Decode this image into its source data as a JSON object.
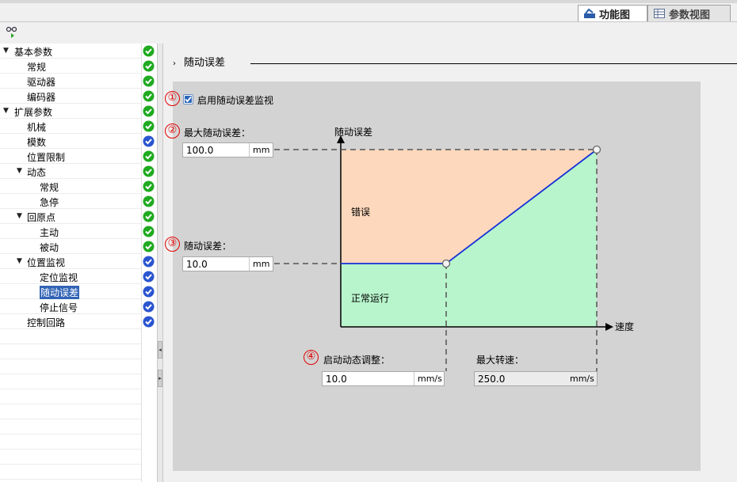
{
  "tabs": {
    "functional_view": "功能图",
    "parameter_view": "参数视图"
  },
  "tree": {
    "items": [
      {
        "label": "基本参数",
        "level": 0,
        "expanded": true,
        "status": "ok"
      },
      {
        "label": "常规",
        "level": 1,
        "status": "ok"
      },
      {
        "label": "驱动器",
        "level": 1,
        "status": "ok"
      },
      {
        "label": "编码器",
        "level": 1,
        "status": "ok"
      },
      {
        "label": "扩展参数",
        "level": 0,
        "expanded": true,
        "status": "ok"
      },
      {
        "label": "机械",
        "level": 1,
        "status": "ok"
      },
      {
        "label": "模数",
        "level": 1,
        "status": "info"
      },
      {
        "label": "位置限制",
        "level": 1,
        "status": "ok"
      },
      {
        "label": "动态",
        "level": 1,
        "expanded": true,
        "status": "ok"
      },
      {
        "label": "常规",
        "level": 2,
        "status": "ok"
      },
      {
        "label": "急停",
        "level": 2,
        "status": "ok"
      },
      {
        "label": "回原点",
        "level": 1,
        "expanded": true,
        "status": "ok"
      },
      {
        "label": "主动",
        "level": 2,
        "status": "ok"
      },
      {
        "label": "被动",
        "level": 2,
        "status": "ok"
      },
      {
        "label": "位置监视",
        "level": 1,
        "expanded": true,
        "status": "info"
      },
      {
        "label": "定位监视",
        "level": 2,
        "status": "info"
      },
      {
        "label": "随动误差",
        "level": 2,
        "status": "info",
        "selected": true
      },
      {
        "label": "停止信号",
        "level": 2,
        "status": "info"
      },
      {
        "label": "控制回路",
        "level": 1,
        "status": "info"
      }
    ]
  },
  "section": {
    "title": "随动误差"
  },
  "form": {
    "enable_checkbox": {
      "number": "①",
      "label": "启用随动误差监视",
      "checked": true
    },
    "max_following_error": {
      "number": "②",
      "label": "最大随动误差：",
      "value": "100.0",
      "unit": "mm"
    },
    "following_error": {
      "number": "③",
      "label": "随动误差：",
      "value": "10.0",
      "unit": "mm"
    },
    "start_dynamic_adjust": {
      "number": "④",
      "label": "启动动态调整：",
      "value": "10.0",
      "unit": "mm/s"
    },
    "max_speed": {
      "label": "最大转速：",
      "value": "250.0",
      "unit": "mm/s"
    }
  },
  "diagram": {
    "y_axis_label": "随动误差",
    "x_axis_label": "速度",
    "region_error": "错误",
    "region_normal": "正常运行"
  },
  "colors": {
    "status_ok": "#1faa1f",
    "status_info": "#2a55d0",
    "region_error": "#fdd8bc",
    "region_normal": "#b8f5cc",
    "limit_line": "#1530d8",
    "annotation_red": "#e00000"
  }
}
